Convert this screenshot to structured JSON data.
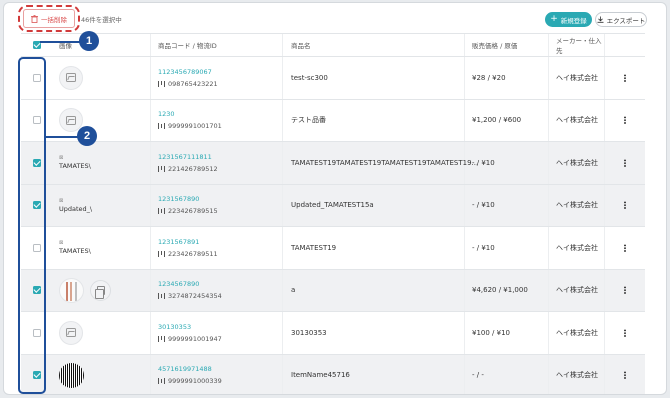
{
  "toolbar": {
    "bulk_delete_label": "一括削除",
    "selection_text": "46件を選択中",
    "new_label": "新規登録",
    "export_label": "エクスポート"
  },
  "table": {
    "headers": {
      "image": "画像",
      "code": "商品コード / 物流ID",
      "name": "商品名",
      "price": "販売価格 / 原価",
      "maker": "メーカー・仕入先"
    },
    "rows": [
      {
        "selected": false,
        "image": "placeholder",
        "code": "1123456789067",
        "logistics_id": "098765423221",
        "name": "test-sc300",
        "price": "¥28 / ¥20",
        "maker": "ヘイ株式会社"
      },
      {
        "selected": false,
        "image": "placeholder",
        "code": "1230",
        "logistics_id": "9999991001701",
        "name": "テスト品番",
        "price": "¥1,200 / ¥600",
        "maker": "ヘイ株式会社"
      },
      {
        "selected": true,
        "image": "broken",
        "image_alt": "TAMATES\\",
        "code": "1231567111811",
        "logistics_id": "221426789512",
        "name": "TAMATEST19TAMATEST19TAMATEST19TAMATEST19...",
        "price": "- / ¥10",
        "maker": "ヘイ株式会社"
      },
      {
        "selected": true,
        "image": "broken",
        "image_alt": "Updated_\\",
        "code": "1231567890",
        "logistics_id": "223426789515",
        "name": "Updated_TAMATEST15a",
        "price": "- / ¥10",
        "maker": "ヘイ株式会社"
      },
      {
        "selected": false,
        "image": "broken",
        "image_alt": "TAMATES\\",
        "code": "1231567891",
        "logistics_id": "223426789511",
        "name": "TAMATEST19",
        "price": "- / ¥10",
        "maker": "ヘイ株式会社"
      },
      {
        "selected": true,
        "image": "photo",
        "code": "1234567890",
        "logistics_id": "3274872454354",
        "name": "a",
        "price": "¥4,620 / ¥1,000",
        "maker": "ヘイ株式会社"
      },
      {
        "selected": false,
        "image": "placeholder",
        "code": "30130353",
        "logistics_id": "9999991001947",
        "name": "30130353",
        "price": "¥100 / ¥10",
        "maker": "ヘイ株式会社"
      },
      {
        "selected": true,
        "image": "barcode",
        "code": "4571619971488",
        "logistics_id": "9999991000339",
        "name": "ItemName45716",
        "price": "- / -",
        "maker": "ヘイ株式会社"
      }
    ]
  },
  "annotations": {
    "badge_1": "1",
    "badge_2": "2"
  },
  "colors": {
    "accent": "#2aa9b3",
    "danger": "#d94b4b",
    "annotation": "#1f4f9a"
  }
}
